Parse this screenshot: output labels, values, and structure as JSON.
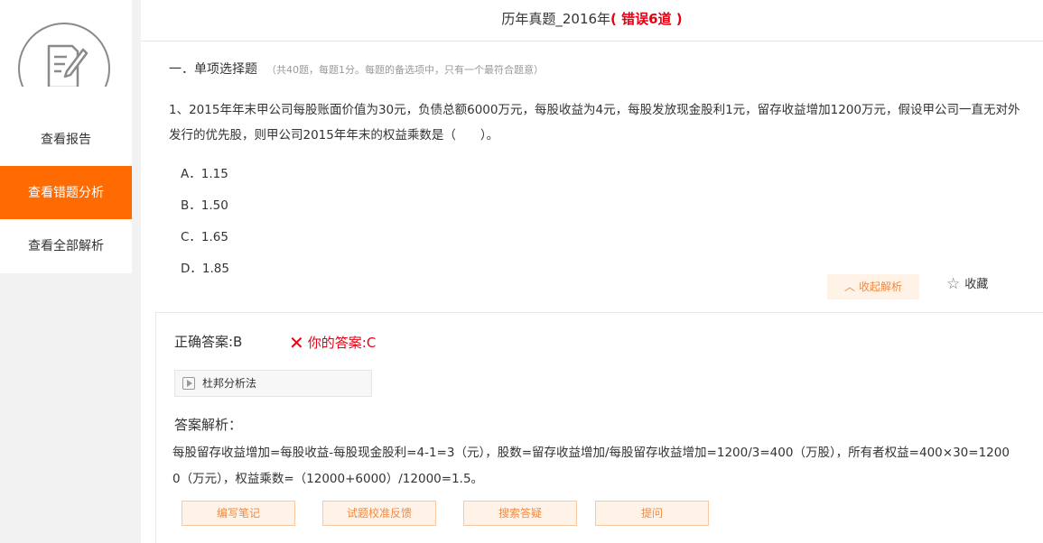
{
  "sidebar": {
    "logo_icon": "exam-paper-edit-icon",
    "items": [
      {
        "label": "查看报告",
        "active": false
      },
      {
        "label": "查看错题分析",
        "active": true
      },
      {
        "label": "查看全部解析",
        "active": false
      }
    ]
  },
  "header": {
    "title": "历年真题_2016年",
    "error_label": "( 错误6道 )"
  },
  "section": {
    "title": "一．单项选择题",
    "note": "（共40题，每题1分。每题的备选项中，只有一个最符合题意）"
  },
  "question": {
    "line1": "1、2015年年末甲公司每股账面价值为30元，负债总额6000万元，每股收益为4元，每股发放现金股利1元，留存收益增加1200万元，假设甲公司一直无对外",
    "line2": "发行的优先股，则甲公司2015年年末的权益乘数是（　　）。",
    "options": [
      {
        "label": "A．1.15"
      },
      {
        "label": "B．1.50"
      },
      {
        "label": "C．1.65"
      },
      {
        "label": "D．1.85"
      }
    ]
  },
  "actions": {
    "collapse_label": "收起解析",
    "favorite_label": "收藏"
  },
  "answer": {
    "correct": "正确答案:B",
    "yours": "你的答案:C",
    "video_label": "杜邦分析法",
    "analysis_title": "答案解析：",
    "analysis_line1": "每股留存收益增加=每股收益-每股现金股利=4-1=3（元），股数=留存收益增加/每股留存收益增加=1200/3=400（万股），所有者权益=400×30=1200",
    "analysis_line2": "0（万元），权益乘数=（12000+6000）/12000=1.5。"
  },
  "buttons": [
    {
      "label": "编写笔记"
    },
    {
      "label": "试题校准反馈"
    },
    {
      "label": "搜索答疑"
    },
    {
      "label": "提问"
    }
  ],
  "colors": {
    "accent": "#ff6b00",
    "error": "#e60012",
    "button_bg": "#fff3e8",
    "button_text": "#f08a44"
  }
}
